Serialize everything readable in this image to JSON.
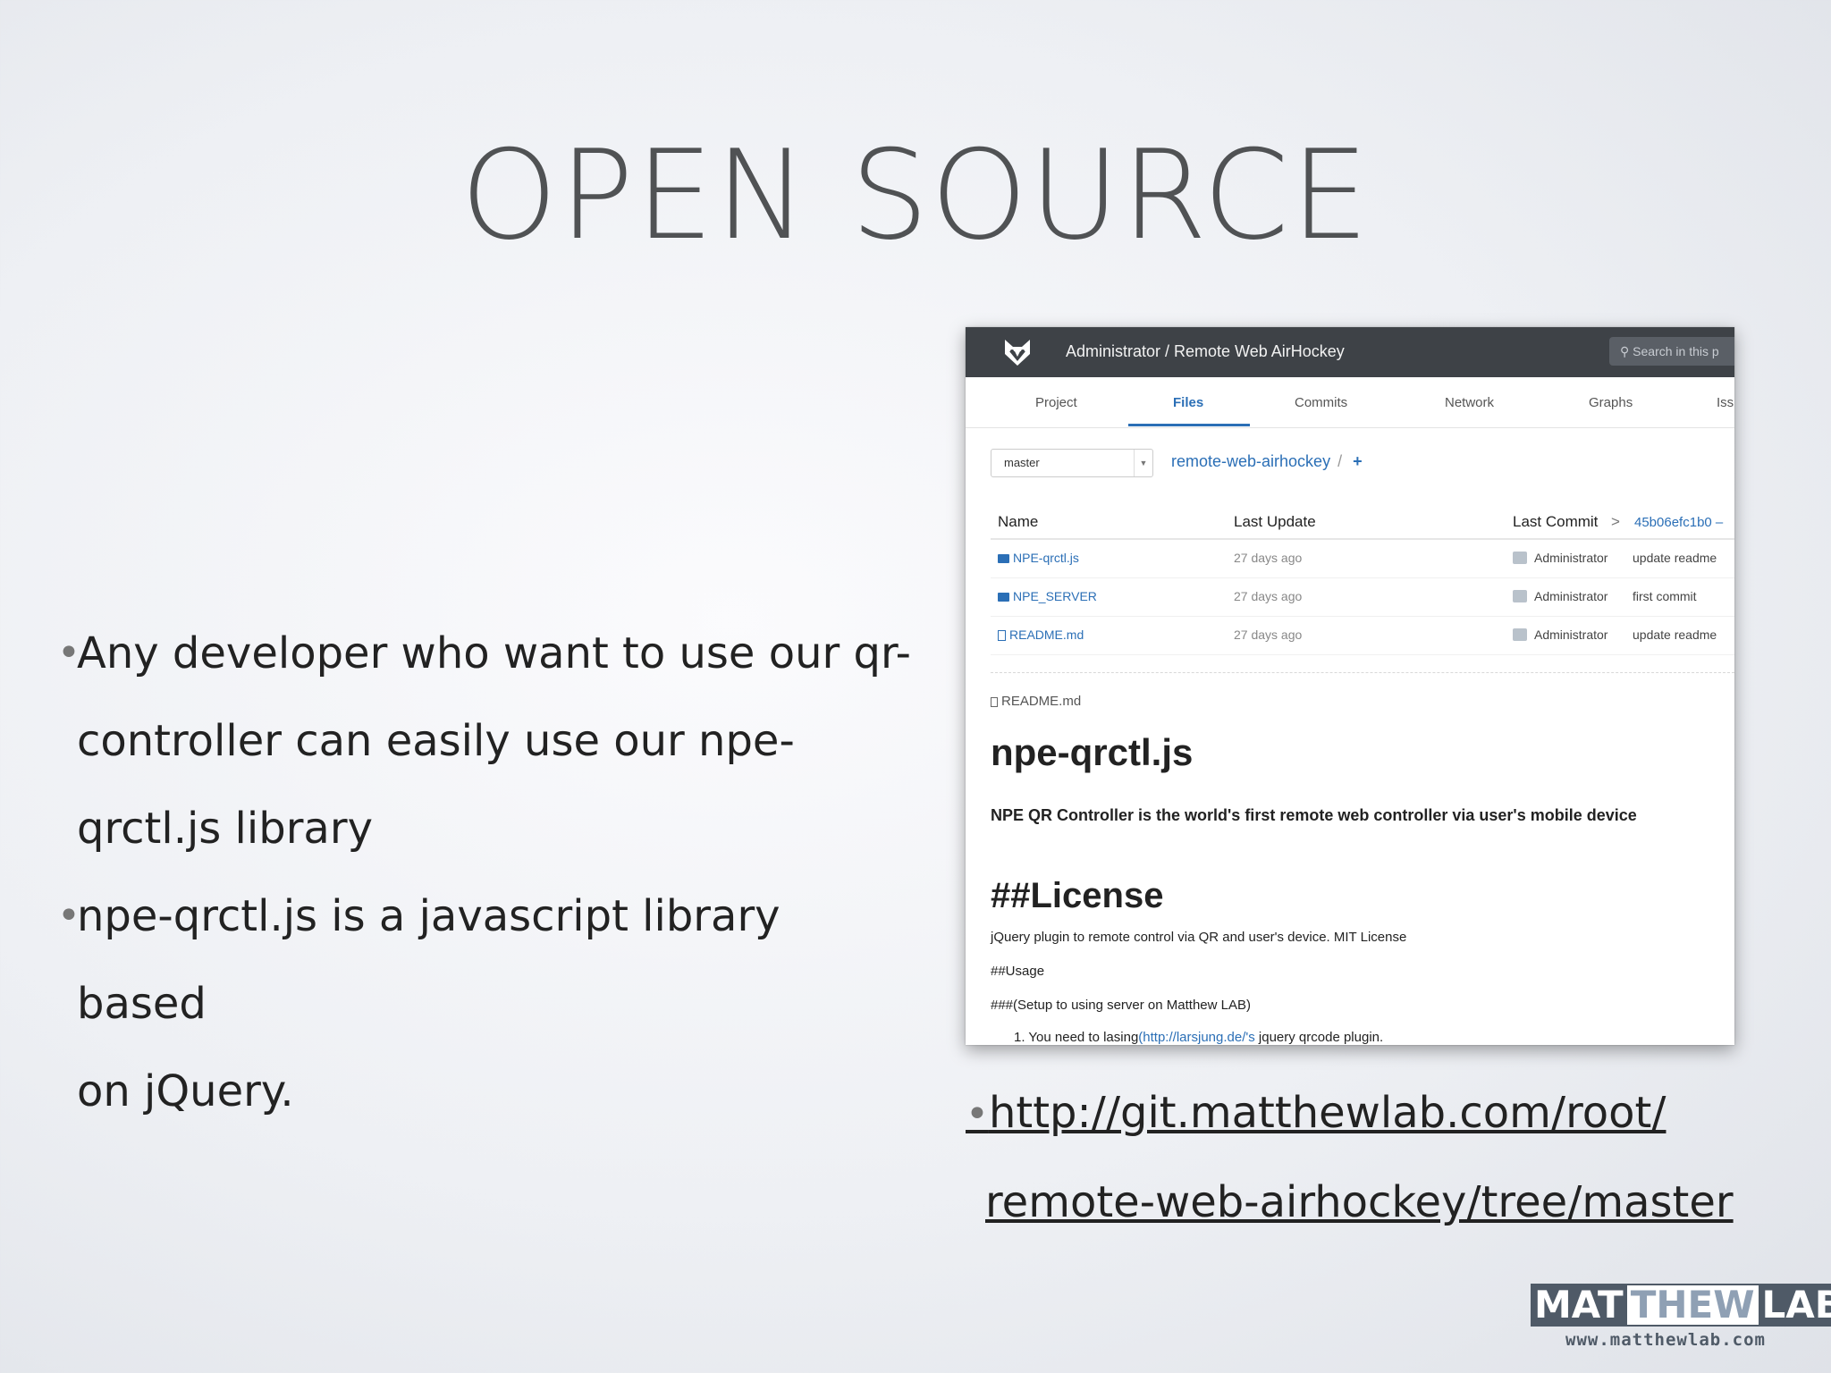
{
  "slide": {
    "title": "OPEN SOURCE",
    "bullets": [
      {
        "lines": [
          "Any developer who want to use our qr-",
          "controller can easily use our npe-",
          "qrctl.js library"
        ]
      },
      {
        "lines": [
          "npe-qrctl.js is a javascript library based",
          "on jQuery."
        ]
      }
    ],
    "bullet_glyph": "•",
    "link_lines": [
      "http://git.matthewlab.com/root/",
      "remote-web-airhockey/tree/master"
    ]
  },
  "screenshot": {
    "header": {
      "title": "Administrator / Remote Web AirHockey",
      "search_placeholder": "Search in this p",
      "logo_icon": "fox-logo-icon"
    },
    "tabs": [
      {
        "label": "Project",
        "active": false
      },
      {
        "label": "Files",
        "active": true
      },
      {
        "label": "Commits",
        "active": false
      },
      {
        "label": "Network",
        "active": false
      },
      {
        "label": "Graphs",
        "active": false
      },
      {
        "label": "Iss",
        "active": false
      }
    ],
    "branch": "master",
    "breadcrumb": {
      "repo": "remote-web-airhockey",
      "sep": "/",
      "plus": "+"
    },
    "table": {
      "headers": {
        "name": "Name",
        "last_update": "Last Update",
        "last_commit": "Last Commit",
        "commit_arrow": ">",
        "commit_hash": "45b06efc1b0 –"
      },
      "rows": [
        {
          "name": "NPE-qrctl.js",
          "type": "folder",
          "updated": "27 days ago",
          "author": "Administrator",
          "message": "update readme"
        },
        {
          "name": "NPE_SERVER",
          "type": "folder",
          "updated": "27 days ago",
          "author": "Administrator",
          "message": "first commit"
        },
        {
          "name": "README.md",
          "type": "file",
          "updated": "27 days ago",
          "author": "Administrator",
          "message": "update readme"
        }
      ]
    },
    "readme": {
      "label": "README.md",
      "heading": "npe-qrctl.js",
      "description": "NPE QR Controller is the world's first remote web controller via user's mobile device",
      "license_heading": "##License",
      "license_text": "jQuery plugin to remote control via QR and user's device. MIT License",
      "usage": "##Usage",
      "setup": "###(Setup to using server on Matthew LAB)",
      "step1_prefix": "1.  You need to lasing",
      "step1_link": "(http://larsjung.de/'s",
      "step1_suffix": " jquery qrcode plugin."
    }
  },
  "logo": {
    "part1": "MAT",
    "part2": "THEW",
    "part3": "LAB",
    "url": "www.matthewlab.com",
    "color_dark": "#4f5a67",
    "color_light": "#8fa0b4"
  }
}
